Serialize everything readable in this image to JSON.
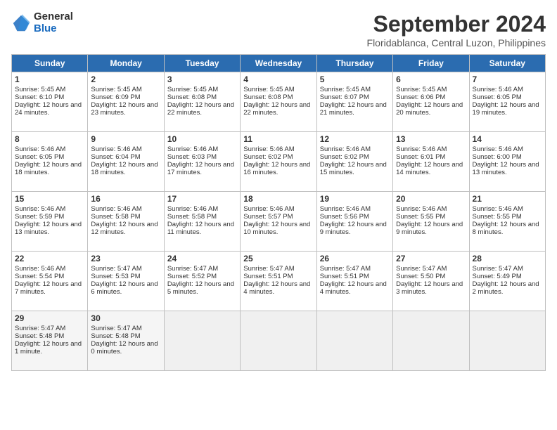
{
  "logo": {
    "general": "General",
    "blue": "Blue"
  },
  "title": "September 2024",
  "location": "Floridablanca, Central Luzon, Philippines",
  "headers": [
    "Sunday",
    "Monday",
    "Tuesday",
    "Wednesday",
    "Thursday",
    "Friday",
    "Saturday"
  ],
  "days": [
    {
      "num": "",
      "info": ""
    },
    {
      "num": "",
      "info": ""
    },
    {
      "num": "",
      "info": ""
    },
    {
      "num": "",
      "info": ""
    },
    {
      "num": "",
      "info": ""
    },
    {
      "num": "",
      "info": ""
    },
    {
      "num": "",
      "info": ""
    },
    {
      "num": "1",
      "sunrise": "5:45 AM",
      "sunset": "6:10 PM",
      "daylight": "12 hours and 24 minutes."
    },
    {
      "num": "2",
      "sunrise": "5:45 AM",
      "sunset": "6:09 PM",
      "daylight": "12 hours and 23 minutes."
    },
    {
      "num": "3",
      "sunrise": "5:45 AM",
      "sunset": "6:08 PM",
      "daylight": "12 hours and 22 minutes."
    },
    {
      "num": "4",
      "sunrise": "5:45 AM",
      "sunset": "6:08 PM",
      "daylight": "12 hours and 22 minutes."
    },
    {
      "num": "5",
      "sunrise": "5:45 AM",
      "sunset": "6:07 PM",
      "daylight": "12 hours and 21 minutes."
    },
    {
      "num": "6",
      "sunrise": "5:45 AM",
      "sunset": "6:06 PM",
      "daylight": "12 hours and 20 minutes."
    },
    {
      "num": "7",
      "sunrise": "5:46 AM",
      "sunset": "6:05 PM",
      "daylight": "12 hours and 19 minutes."
    },
    {
      "num": "8",
      "sunrise": "5:46 AM",
      "sunset": "6:05 PM",
      "daylight": "12 hours and 18 minutes."
    },
    {
      "num": "9",
      "sunrise": "5:46 AM",
      "sunset": "6:04 PM",
      "daylight": "12 hours and 18 minutes."
    },
    {
      "num": "10",
      "sunrise": "5:46 AM",
      "sunset": "6:03 PM",
      "daylight": "12 hours and 17 minutes."
    },
    {
      "num": "11",
      "sunrise": "5:46 AM",
      "sunset": "6:02 PM",
      "daylight": "12 hours and 16 minutes."
    },
    {
      "num": "12",
      "sunrise": "5:46 AM",
      "sunset": "6:02 PM",
      "daylight": "12 hours and 15 minutes."
    },
    {
      "num": "13",
      "sunrise": "5:46 AM",
      "sunset": "6:01 PM",
      "daylight": "12 hours and 14 minutes."
    },
    {
      "num": "14",
      "sunrise": "5:46 AM",
      "sunset": "6:00 PM",
      "daylight": "12 hours and 13 minutes."
    },
    {
      "num": "15",
      "sunrise": "5:46 AM",
      "sunset": "5:59 PM",
      "daylight": "12 hours and 13 minutes."
    },
    {
      "num": "16",
      "sunrise": "5:46 AM",
      "sunset": "5:58 PM",
      "daylight": "12 hours and 12 minutes."
    },
    {
      "num": "17",
      "sunrise": "5:46 AM",
      "sunset": "5:58 PM",
      "daylight": "12 hours and 11 minutes."
    },
    {
      "num": "18",
      "sunrise": "5:46 AM",
      "sunset": "5:57 PM",
      "daylight": "12 hours and 10 minutes."
    },
    {
      "num": "19",
      "sunrise": "5:46 AM",
      "sunset": "5:56 PM",
      "daylight": "12 hours and 9 minutes."
    },
    {
      "num": "20",
      "sunrise": "5:46 AM",
      "sunset": "5:55 PM",
      "daylight": "12 hours and 9 minutes."
    },
    {
      "num": "21",
      "sunrise": "5:46 AM",
      "sunset": "5:55 PM",
      "daylight": "12 hours and 8 minutes."
    },
    {
      "num": "22",
      "sunrise": "5:46 AM",
      "sunset": "5:54 PM",
      "daylight": "12 hours and 7 minutes."
    },
    {
      "num": "23",
      "sunrise": "5:47 AM",
      "sunset": "5:53 PM",
      "daylight": "12 hours and 6 minutes."
    },
    {
      "num": "24",
      "sunrise": "5:47 AM",
      "sunset": "5:52 PM",
      "daylight": "12 hours and 5 minutes."
    },
    {
      "num": "25",
      "sunrise": "5:47 AM",
      "sunset": "5:51 PM",
      "daylight": "12 hours and 4 minutes."
    },
    {
      "num": "26",
      "sunrise": "5:47 AM",
      "sunset": "5:51 PM",
      "daylight": "12 hours and 4 minutes."
    },
    {
      "num": "27",
      "sunrise": "5:47 AM",
      "sunset": "5:50 PM",
      "daylight": "12 hours and 3 minutes."
    },
    {
      "num": "28",
      "sunrise": "5:47 AM",
      "sunset": "5:49 PM",
      "daylight": "12 hours and 2 minutes."
    },
    {
      "num": "29",
      "sunrise": "5:47 AM",
      "sunset": "5:48 PM",
      "daylight": "12 hours and 1 minute."
    },
    {
      "num": "30",
      "sunrise": "5:47 AM",
      "sunset": "5:48 PM",
      "daylight": "12 hours and 0 minutes."
    },
    {
      "num": "",
      "info": ""
    },
    {
      "num": "",
      "info": ""
    },
    {
      "num": "",
      "info": ""
    },
    {
      "num": "",
      "info": ""
    },
    {
      "num": "",
      "info": ""
    }
  ]
}
